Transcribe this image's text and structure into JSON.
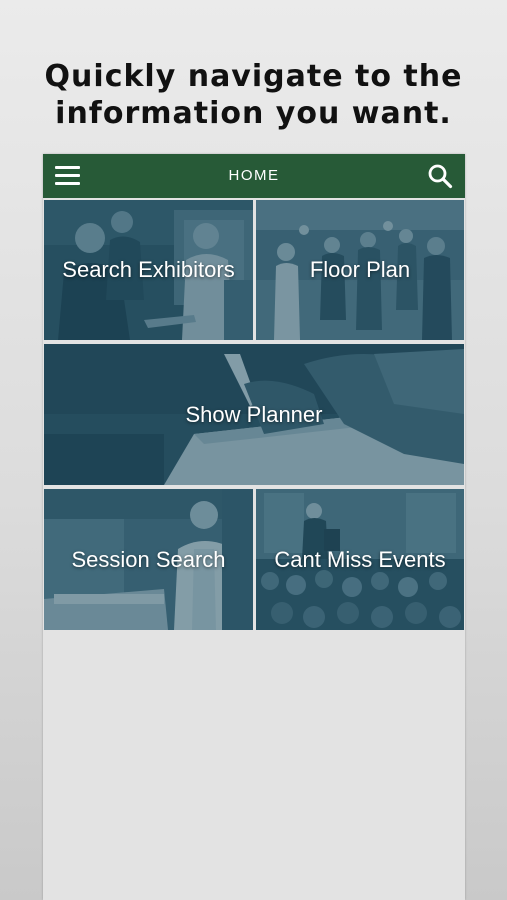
{
  "headline": {
    "line1": "Quickly navigate to the",
    "line2": "information you want."
  },
  "navbar": {
    "title": "HOME",
    "menu_icon": "hamburger-menu-icon",
    "search_icon": "search-icon",
    "background": "#275a37"
  },
  "tiles": [
    {
      "label": "Search Exhibitors"
    },
    {
      "label": "Floor Plan"
    },
    {
      "label": "Show Planner"
    },
    {
      "label": "Session Search"
    },
    {
      "label": "Cant Miss Events"
    }
  ],
  "colors": {
    "tile_tint": "#1c4658",
    "content_background": "#e3e3e3"
  }
}
